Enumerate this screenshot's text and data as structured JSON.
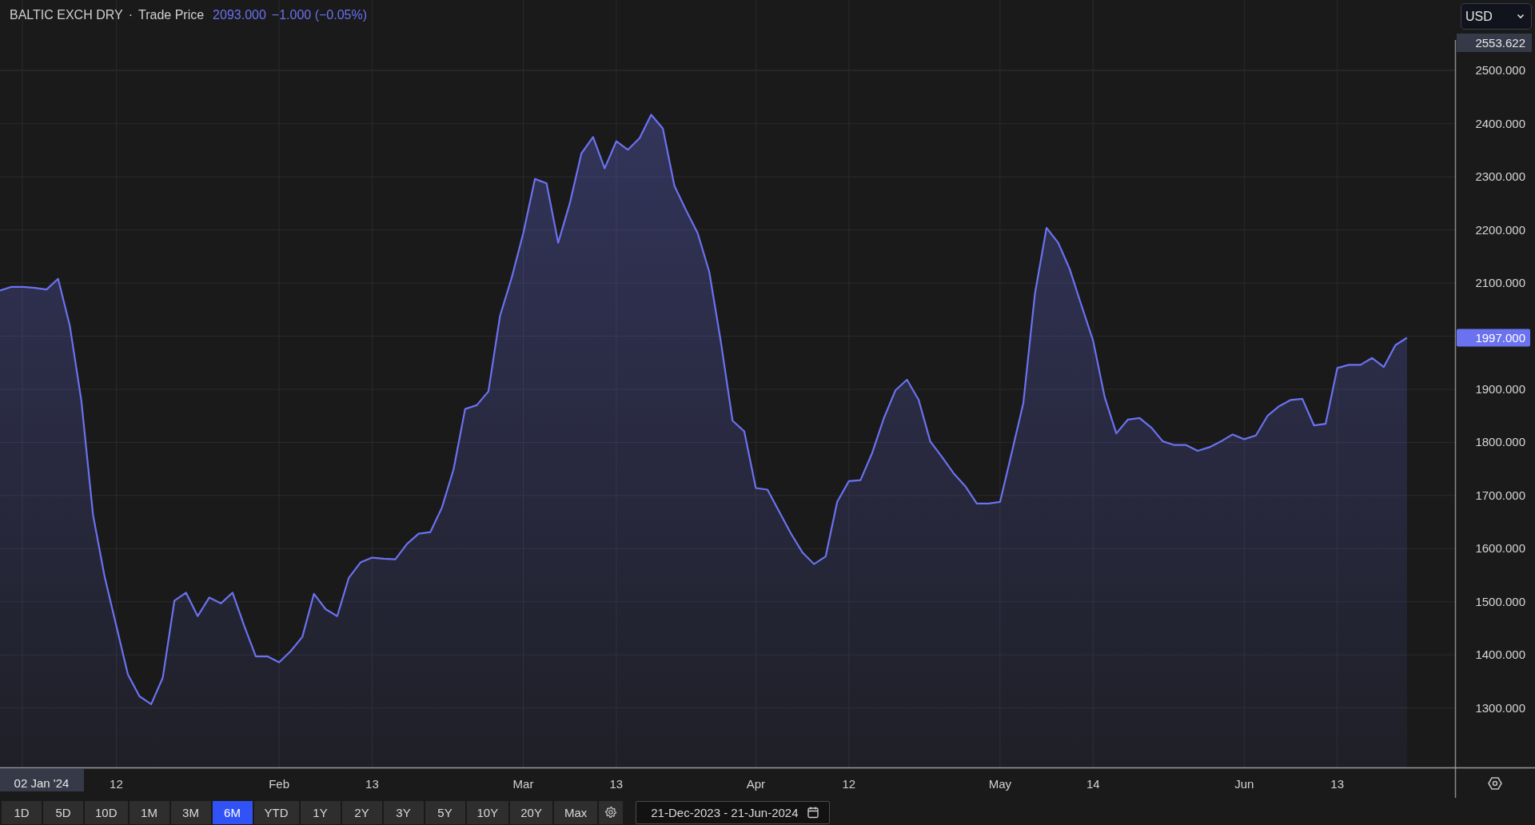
{
  "header": {
    "symbol": "BALTIC EXCH DRY",
    "separator": "·",
    "price": "2093.000",
    "change": "−1.000 (−0.05%)"
  },
  "currency_select": {
    "value": "USD"
  },
  "crosshair": {
    "price_label": "2553.622",
    "date_label": "02 Jan '24"
  },
  "last_price_label": "1997.000",
  "chart_data": {
    "type": "area",
    "grid": true,
    "categories": [
      null,
      null,
      null,
      null,
      null,
      null,
      null,
      null,
      null,
      null,
      "12",
      null,
      null,
      null,
      null,
      null,
      null,
      null,
      null,
      null,
      null,
      null,
      null,
      null,
      "Feb",
      null,
      null,
      null,
      null,
      null,
      null,
      null,
      "13",
      null,
      null,
      null,
      null,
      null,
      null,
      null,
      null,
      null,
      null,
      null,
      null,
      "Mar",
      null,
      null,
      null,
      null,
      null,
      null,
      null,
      "13",
      null,
      null,
      null,
      null,
      null,
      null,
      null,
      null,
      null,
      null,
      null,
      "Apr",
      null,
      null,
      null,
      null,
      null,
      null,
      null,
      "12",
      null,
      null,
      null,
      null,
      null,
      null,
      null,
      null,
      null,
      null,
      null,
      null,
      "May",
      null,
      null,
      null,
      null,
      null,
      null,
      null,
      "14",
      null,
      null,
      null,
      null,
      null,
      null,
      null,
      null,
      null,
      null,
      null,
      null,
      "Jun",
      null,
      null,
      null,
      null,
      null,
      null,
      null,
      "13",
      null,
      null,
      null,
      null,
      null,
      null
    ],
    "series": [
      {
        "name": "Trade Price",
        "color": "#6b72f0",
        "values": [
          2086,
          2093,
          2093,
          2091,
          2088,
          2108,
          2020,
          1878,
          1663,
          1547,
          1455,
          1363,
          1322,
          1307,
          1357,
          1502,
          1517,
          1473,
          1508,
          1497,
          1517,
          1455,
          1397,
          1397,
          1386,
          1407,
          1434,
          1515,
          1486,
          1473,
          1545,
          1574,
          1583,
          1581,
          1580,
          1609,
          1628,
          1631,
          1677,
          1749,
          1863,
          1870,
          1896,
          2038,
          2110,
          2194,
          2296,
          2288,
          2176,
          2250,
          2344,
          2375,
          2316,
          2367,
          2351,
          2373,
          2417,
          2391,
          2283,
          2237,
          2194,
          2121,
          1988,
          1841,
          1821,
          1714,
          1711,
          1670,
          1629,
          1593,
          1571,
          1585,
          1688,
          1727,
          1729,
          1780,
          1845,
          1898,
          1918,
          1880,
          1802,
          1773,
          1742,
          1718,
          1685,
          1685,
          1688,
          1780,
          1874,
          2080,
          2204,
          2176,
          2126,
          2058,
          1992,
          1885,
          1817,
          1843,
          1846,
          1828,
          1802,
          1795,
          1795,
          1784,
          1791,
          1802,
          1815,
          1806,
          1813,
          1850,
          1868,
          1880,
          1882,
          1832,
          1835,
          1940,
          1946,
          1946,
          1959,
          1942,
          1983,
          1997
        ]
      }
    ],
    "ylim": [
      1188,
      2633
    ],
    "yticks": [
      {
        "value": 2500,
        "label": "2500.000"
      },
      {
        "value": 2400,
        "label": "2400.000"
      },
      {
        "value": 2300,
        "label": "2300.000"
      },
      {
        "value": 2200,
        "label": "2200.000"
      },
      {
        "value": 2100,
        "label": "2100.000"
      },
      {
        "value": 1900,
        "label": "1900.000"
      },
      {
        "value": 1800,
        "label": "1800.000"
      },
      {
        "value": 1700,
        "label": "1700.000"
      },
      {
        "value": 1600,
        "label": "1600.000"
      },
      {
        "value": 1500,
        "label": "1500.000"
      },
      {
        "value": 1400,
        "label": "1400.000"
      },
      {
        "value": 1300,
        "label": "1300.000"
      }
    ]
  },
  "range_buttons": [
    {
      "label": "1D",
      "selected": false
    },
    {
      "label": "5D",
      "selected": false
    },
    {
      "label": "10D",
      "selected": false
    },
    {
      "label": "1M",
      "selected": false
    },
    {
      "label": "3M",
      "selected": false
    },
    {
      "label": "6M",
      "selected": true
    },
    {
      "label": "YTD",
      "selected": false
    },
    {
      "label": "1Y",
      "selected": false
    },
    {
      "label": "2Y",
      "selected": false
    },
    {
      "label": "3Y",
      "selected": false
    },
    {
      "label": "5Y",
      "selected": false
    },
    {
      "label": "10Y",
      "selected": false
    },
    {
      "label": "20Y",
      "selected": false
    },
    {
      "label": "Max",
      "selected": false
    }
  ],
  "date_range": {
    "start": "21-Dec-2023",
    "separator": "-",
    "end": "21-Jun-2024"
  }
}
